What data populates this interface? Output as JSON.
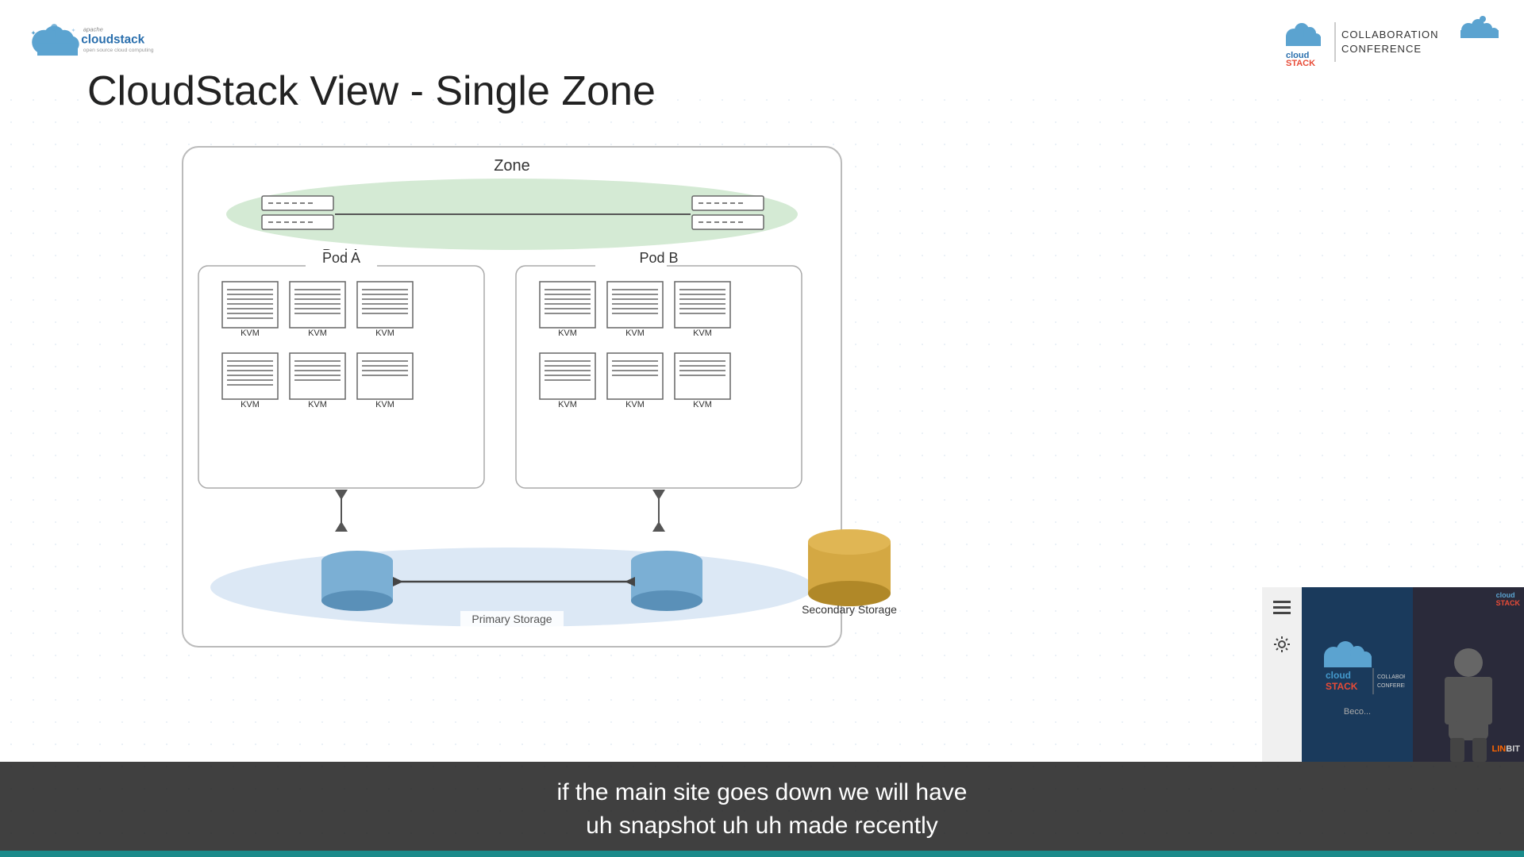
{
  "header": {
    "left_logo_alt": "Apache CloudStack",
    "right_logo_alt": "CloudStack Collaboration Conference",
    "cloudstack_text": "cloud\nSTACK",
    "conference_text": "COLLABORATION\nCONFERENCE"
  },
  "slide": {
    "title": "CloudStack View - Single Zone",
    "zone_label": "Zone",
    "pod_a_label": "Pod A",
    "pod_b_label": "Pod B",
    "kvm_label": "KVM",
    "primary_storage_label": "Primary Storage",
    "secondary_storage_label": "Secondary Storage"
  },
  "subtitles": {
    "line1": "if the main site goes down we will have",
    "line2": "uh snapshot uh uh made recently"
  },
  "video": {
    "become_text": "Beco..."
  }
}
